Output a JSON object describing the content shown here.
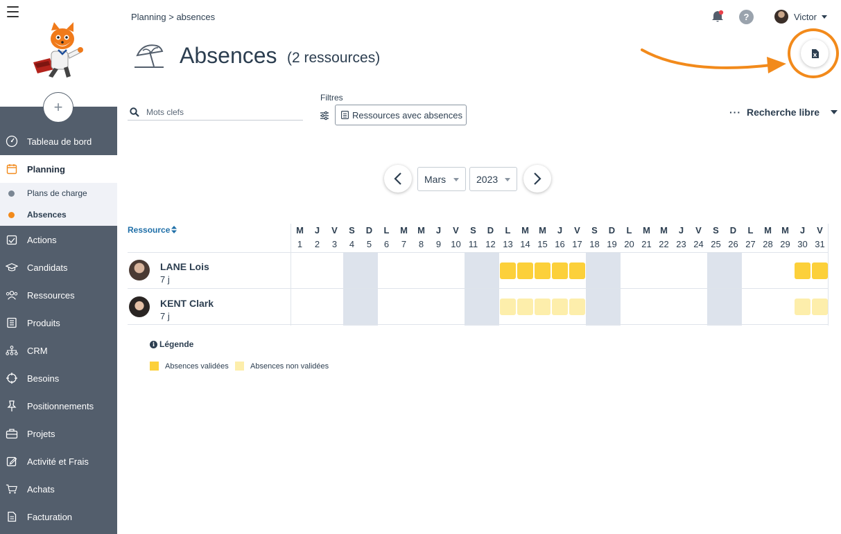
{
  "breadcrumb": {
    "parent": "Planning",
    "separator": ">",
    "current": "absences"
  },
  "user": {
    "name": "Victor"
  },
  "page": {
    "title": "Absences",
    "subtitle": "(2 ressources)"
  },
  "search": {
    "placeholder": "Mots clefs"
  },
  "filters": {
    "label": "Filtres",
    "chip": "Ressources avec absences"
  },
  "free_search": {
    "label": "Recherche libre"
  },
  "period": {
    "month": "Mars",
    "year": "2023"
  },
  "sidebar": {
    "add_symbol": "+",
    "items": [
      {
        "label": "Tableau de bord",
        "icon": "dashboard-icon"
      },
      {
        "label": "Planning",
        "icon": "calendar-icon",
        "active": true
      },
      {
        "label": "Actions",
        "icon": "checklist-icon"
      },
      {
        "label": "Candidats",
        "icon": "graduation-cap-icon"
      },
      {
        "label": "Ressources",
        "icon": "people-icon"
      },
      {
        "label": "Produits",
        "icon": "document-icon"
      },
      {
        "label": "CRM",
        "icon": "org-chart-icon"
      },
      {
        "label": "Besoins",
        "icon": "target-icon"
      },
      {
        "label": "Positionnements",
        "icon": "pin-icon"
      },
      {
        "label": "Projets",
        "icon": "briefcase-icon"
      },
      {
        "label": "Activité et Frais",
        "icon": "edit-icon"
      },
      {
        "label": "Achats",
        "icon": "cart-icon"
      },
      {
        "label": "Facturation",
        "icon": "invoice-icon"
      }
    ],
    "subitems": [
      {
        "label": "Plans de charge",
        "color": "#7b8794"
      },
      {
        "label": "Absences",
        "color": "#f28a1b",
        "active": true
      }
    ]
  },
  "grid": {
    "resource_header": "Ressource",
    "day_letters": [
      "M",
      "J",
      "V",
      "S",
      "D",
      "L",
      "M",
      "M",
      "J",
      "V",
      "S",
      "D",
      "L",
      "M",
      "M",
      "J",
      "V",
      "S",
      "D",
      "L",
      "M",
      "M",
      "J",
      "V",
      "S",
      "D",
      "L",
      "M",
      "M",
      "J",
      "V"
    ],
    "day_numbers": [
      "1",
      "2",
      "3",
      "4",
      "5",
      "6",
      "7",
      "8",
      "9",
      "10",
      "11",
      "12",
      "13",
      "14",
      "15",
      "16",
      "17",
      "18",
      "19",
      "20",
      "21",
      "22",
      "23",
      "24",
      "25",
      "26",
      "27",
      "28",
      "29",
      "30",
      "31"
    ],
    "weekend_days": [
      4,
      5,
      11,
      12,
      18,
      19,
      25,
      26
    ],
    "rows": [
      {
        "name": "LANE Lois",
        "days": "7 j",
        "status": "validated",
        "absent_days": [
          13,
          14,
          15,
          16,
          17,
          30,
          31
        ]
      },
      {
        "name": "KENT Clark",
        "days": "7 j",
        "status": "unvalidated",
        "absent_days": [
          13,
          14,
          15,
          16,
          17,
          30,
          31
        ]
      }
    ]
  },
  "legend": {
    "title": "Légende",
    "items": [
      {
        "label": "Absences validées",
        "color": "#fcd03a"
      },
      {
        "label": "Absences non validées",
        "color": "#fdeeab"
      }
    ]
  },
  "colors": {
    "accent": "#f28a1b",
    "sidebar": "#535e6c",
    "weekend": "#dde3ec",
    "validated": "#fcd03a",
    "unvalidated": "#fdeeab"
  }
}
